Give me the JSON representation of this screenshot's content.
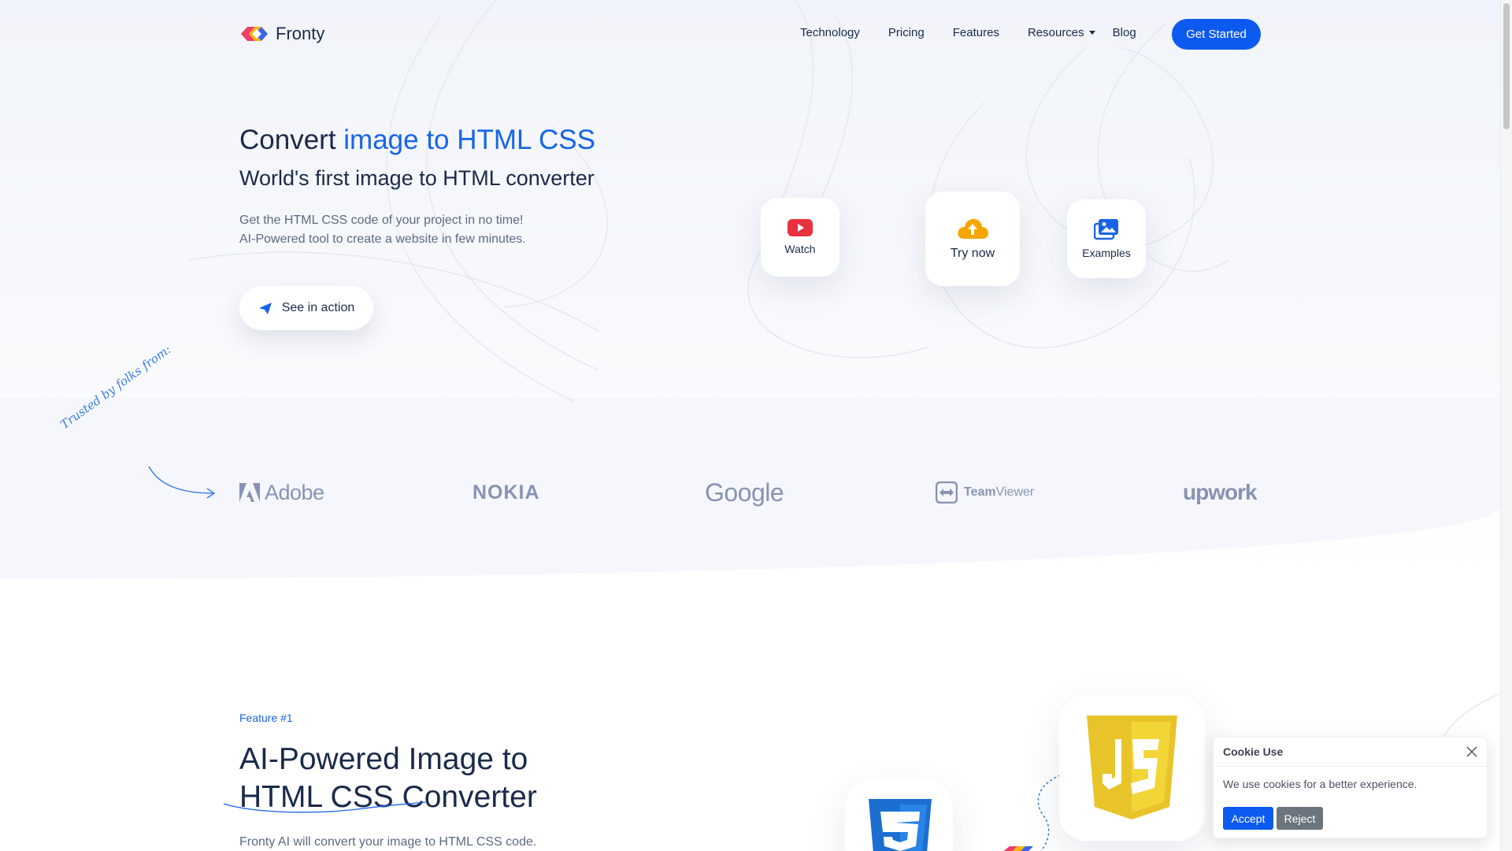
{
  "nav": {
    "brand": "Fronty",
    "links": [
      "Technology",
      "Pricing",
      "Features",
      "Resources",
      "Blog"
    ],
    "cta": "Get Started"
  },
  "hero": {
    "title_prefix": "Convert ",
    "title_accent": "image to HTML CSS",
    "subtitle": "World's first image to HTML converter",
    "lead_1": "Get the HTML CSS code of your project in no time!",
    "lead_2": "AI-Powered tool to create a website in few minutes.",
    "see_action": "See in action",
    "cards": {
      "watch": "Watch",
      "try": "Try now",
      "examples": "Examples"
    }
  },
  "trusted": {
    "label": "Trusted by folks from:",
    "brands": [
      "Adobe",
      "NOKIA",
      "Google",
      "TeamViewer",
      "upwork"
    ],
    "team": "Team",
    "viewer": "Viewer"
  },
  "feature": {
    "tag": "Feature #1",
    "title_1": "AI-Powered Image to",
    "title_2": "HTML CSS Converter",
    "desc": "Fronty AI will convert your image to HTML CSS code."
  },
  "cookie": {
    "title": "Cookie Use",
    "message": "We use cookies for a better experience.",
    "accept": "Accept",
    "reject": "Reject"
  },
  "colors": {
    "primary": "#0d5af0",
    "accent_text": "#1764e8",
    "heading": "#1b2a4a",
    "muted": "#5b6b82",
    "brand_gray": "#8893b3"
  },
  "icons": [
    "logo-mark-icon",
    "caret-down-icon",
    "paper-plane-icon",
    "youtube-play-icon",
    "cloud-upload-icon",
    "images-icon",
    "arrow-icon",
    "teamviewer-icon",
    "javascript-icon",
    "css3-icon",
    "close-icon"
  ]
}
